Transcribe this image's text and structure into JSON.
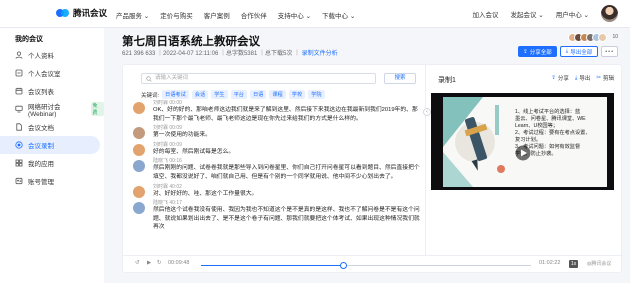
{
  "brand": {
    "logo_text": "腾讯会议",
    "accent": "#1e6fff"
  },
  "nav": [
    "产品服务 ⌄",
    "定价与购买",
    "客户案例",
    "合作伙伴",
    "支持中心 ⌄",
    "下载中心 ⌄"
  ],
  "top_right": {
    "join": "加入会议",
    "host": "发起会议 ⌄",
    "user_center": "用户中心 ⌄"
  },
  "sidebar": {
    "title": "我的会议",
    "items": [
      {
        "label": "个人资料",
        "icon": "user-icon"
      },
      {
        "label": "个人会议室",
        "icon": "room-icon"
      },
      {
        "label": "会议列表",
        "icon": "calendar-icon"
      },
      {
        "label": "网络研讨会(Webinar)",
        "icon": "monitor-icon",
        "badge": "免费"
      },
      {
        "label": "会议文档",
        "icon": "document-icon"
      },
      {
        "label": "会议录制",
        "icon": "record-icon",
        "active": true
      },
      {
        "label": "我的应用",
        "icon": "app-icon"
      },
      {
        "label": "账号管理",
        "icon": "account-icon"
      }
    ]
  },
  "meeting": {
    "title": "第七周日语系统上教研会议",
    "meta": "621 396 633 ｜2022-04-07 12:11:06 ｜总字数5381 ｜总下载5次 ｜",
    "meta_link": "录制文件分析"
  },
  "actions": {
    "share": "分享全部",
    "download": "导出全部",
    "more": "•••",
    "participant_count": "10"
  },
  "search": {
    "placeholder": "请输入关键词",
    "button": "搜索"
  },
  "keywords": {
    "label": "关键词:",
    "items": [
      "日语考试",
      "会话",
      "学生",
      "平台",
      "日语",
      "课程",
      "学校",
      "学院"
    ]
  },
  "transcript": [
    {
      "speaker": "刘时霖 00:00",
      "text": "OK、好的好的、那咱老师这边我们就是来了解到这里、然后接下来我这边在我最新到我们2019年的、那我们一下那个最飞老师、最飞老师这边是现在你先过来给我们的方式是什么样的。",
      "avatar": "#e2a36e"
    },
    {
      "speaker": "刘时霖 00:09",
      "text": "第一次使用的功能来。",
      "avatar": "#c49a7c"
    },
    {
      "speaker": "刘时霖 00:09",
      "text": "好的每室、然后刚试每是怎么。",
      "avatar": "#e2a36e"
    },
    {
      "speaker": "陆晓飞 00:16",
      "text": "然后刚刚的问题、试卷卷我就是那些导入到问卷星里、你们自己打开问卷星可以看到题目、然后直接把个填空、我都没说好了、咱们就自己用、但是有个别的一个同学就用说、他中间不少心划出去了。",
      "avatar": "#8aa7cf"
    },
    {
      "speaker": "刘时霖 40:02",
      "text": "对、好好好的、哇、那这个工作量很大。",
      "avatar": "#e2a36e"
    },
    {
      "speaker": "陆晓飞 40:17",
      "text": "然后他这个试卷我没有使用、我因为我也不知道这个是不是真的是这样、我也不了解问卷是不是有这个问题、就说如果划出出去了、是不是这个卷子有问题、那我们就要把这个体考试、如果出现这种情况我们就再次",
      "avatar": "#8aa7cf"
    }
  ],
  "recording": {
    "title": "录制1",
    "tools": [
      "分享",
      "导出",
      "剪辑"
    ],
    "slide_text": "1、线上考试平台的选择：蓝\n墨云、问卷星、腾讯课堂、WE\nLearn、U校园等；\n2、考试过程：要有在考点设置、\n复习计划。\n3、考试问题：如何有效监督\n学生、防止抄袭。"
  },
  "player": {
    "current": "00:09:48",
    "total": "01:02:22",
    "progress": 0.43,
    "speed": "1x"
  }
}
